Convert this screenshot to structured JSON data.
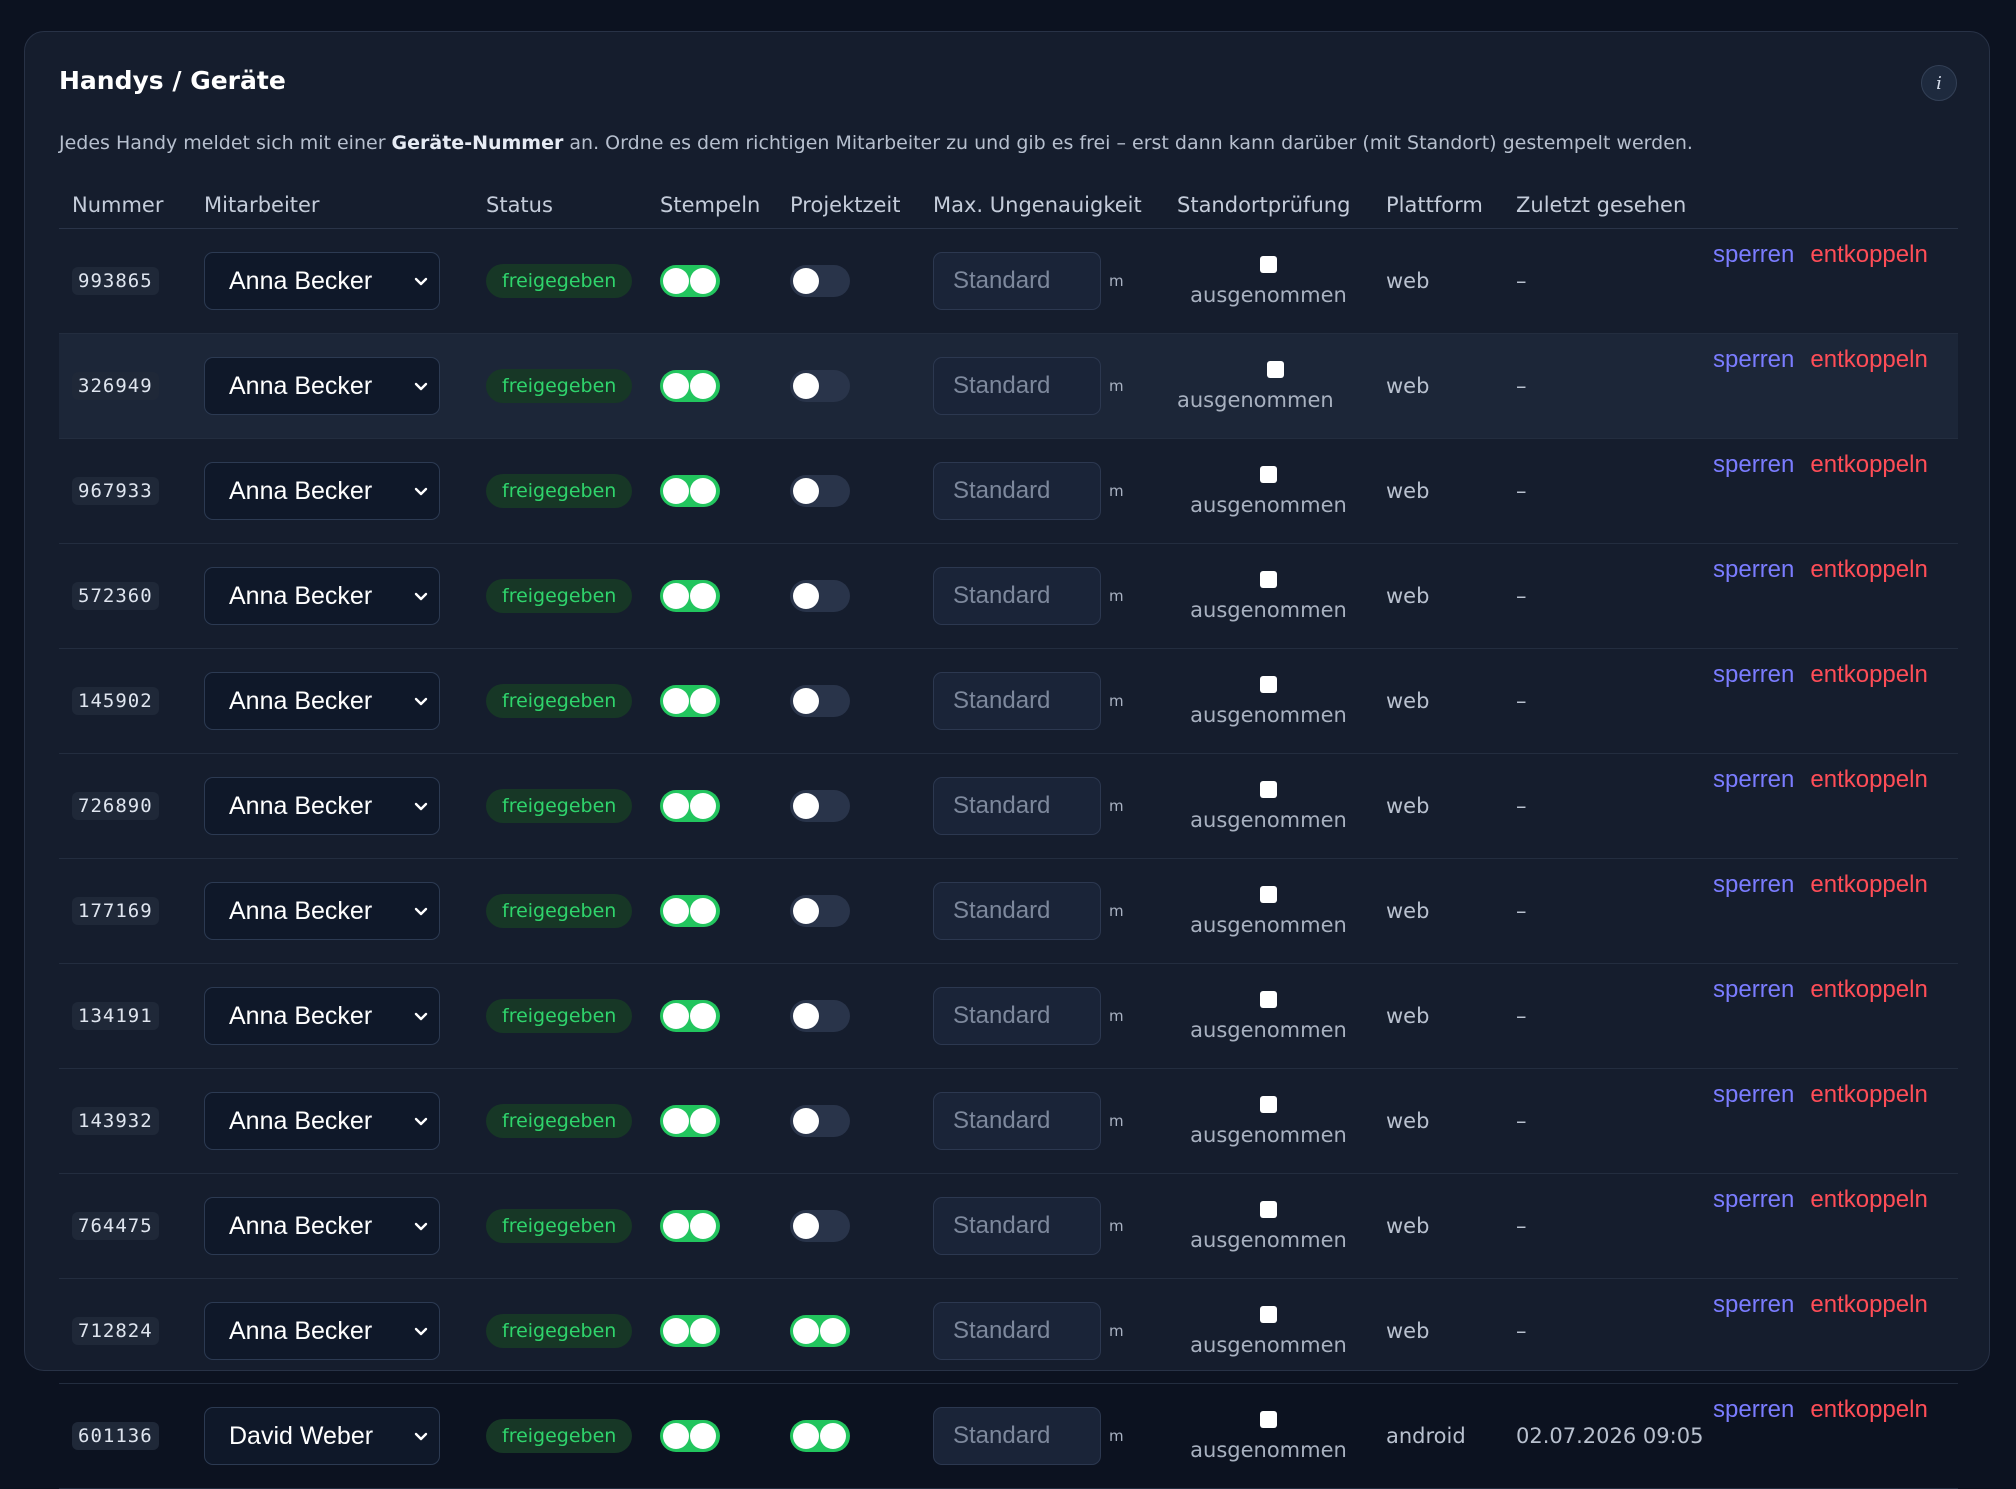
{
  "panel": {
    "title": "Handys / Geräte",
    "info_icon": "i",
    "description_pre": "Jedes Handy meldet sich mit einer ",
    "description_bold": "Geräte-Nummer",
    "description_post": " an. Ordne es dem richtigen Mitarbeiter zu und gib es frei – erst dann kann darüber (mit Standort) gestempelt werden."
  },
  "columns": [
    "Nummer",
    "Mitarbeiter",
    "Status",
    "Stempeln",
    "Projektzeit",
    "Max. Ungenauigkeit",
    "Standortprüfung",
    "Plattform",
    "Zuletzt gesehen"
  ],
  "placeholder": "Standard",
  "unit": "m",
  "exempt_label": "ausgenommen",
  "actions": {
    "lock": "sperren",
    "unlink": "entkoppeln"
  },
  "colors": {
    "accent_green": "#22c55e",
    "lock_link": "#7a7cff",
    "unlink_link": "#ff4d57"
  },
  "devices": [
    {
      "number": "993865",
      "employee": "Anna Becker",
      "status": "freigegeben",
      "clock_in": true,
      "project_time": false,
      "platform": "web",
      "last_seen": "–",
      "exempt": false
    },
    {
      "number": "326949",
      "employee": "Anna Becker",
      "status": "freigegeben",
      "clock_in": true,
      "project_time": false,
      "platform": "web",
      "last_seen": "–",
      "exempt": false
    },
    {
      "number": "967933",
      "employee": "Anna Becker",
      "status": "freigegeben",
      "clock_in": true,
      "project_time": false,
      "platform": "web",
      "last_seen": "–",
      "exempt": false
    },
    {
      "number": "572360",
      "employee": "Anna Becker",
      "status": "freigegeben",
      "clock_in": true,
      "project_time": false,
      "platform": "web",
      "last_seen": "–",
      "exempt": false
    },
    {
      "number": "145902",
      "employee": "Anna Becker",
      "status": "freigegeben",
      "clock_in": true,
      "project_time": false,
      "platform": "web",
      "last_seen": "–",
      "exempt": false
    },
    {
      "number": "726890",
      "employee": "Anna Becker",
      "status": "freigegeben",
      "clock_in": true,
      "project_time": false,
      "platform": "web",
      "last_seen": "–",
      "exempt": false
    },
    {
      "number": "177169",
      "employee": "Anna Becker",
      "status": "freigegeben",
      "clock_in": true,
      "project_time": false,
      "platform": "web",
      "last_seen": "–",
      "exempt": false
    },
    {
      "number": "134191",
      "employee": "Anna Becker",
      "status": "freigegeben",
      "clock_in": true,
      "project_time": false,
      "platform": "web",
      "last_seen": "–",
      "exempt": false
    },
    {
      "number": "143932",
      "employee": "Anna Becker",
      "status": "freigegeben",
      "clock_in": true,
      "project_time": false,
      "platform": "web",
      "last_seen": "–",
      "exempt": false
    },
    {
      "number": "764475",
      "employee": "Anna Becker",
      "status": "freigegeben",
      "clock_in": true,
      "project_time": false,
      "platform": "web",
      "last_seen": "–",
      "exempt": false
    },
    {
      "number": "712824",
      "employee": "Anna Becker",
      "status": "freigegeben",
      "clock_in": true,
      "project_time": true,
      "platform": "web",
      "last_seen": "–",
      "exempt": false
    },
    {
      "number": "601136",
      "employee": "David Weber",
      "status": "freigegeben",
      "clock_in": true,
      "project_time": true,
      "platform": "android",
      "last_seen": "02.07.2026 09:05",
      "exempt": false
    }
  ]
}
